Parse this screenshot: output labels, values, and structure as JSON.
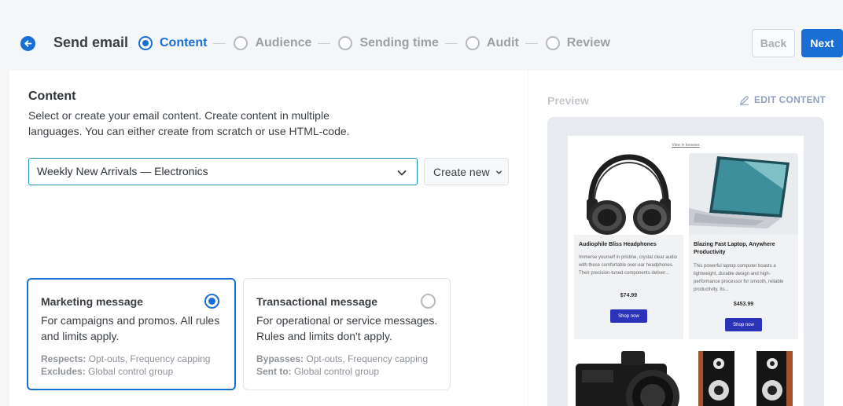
{
  "header": {
    "title": "Send email",
    "steps": [
      {
        "label": "Content",
        "active": true
      },
      {
        "label": "Audience",
        "active": false
      },
      {
        "label": "Sending time",
        "active": false
      },
      {
        "label": "Audit",
        "active": false
      },
      {
        "label": "Review",
        "active": false
      }
    ],
    "back_label": "Back",
    "next_label": "Next"
  },
  "content": {
    "heading": "Content",
    "description": "Select or create your email content. Create content in multiple languages. You can either create from scratch or use HTML-code.",
    "selected_content": "Weekly New Arrivals — Electronics",
    "create_new_label": "Create new"
  },
  "message_types": {
    "marketing": {
      "title": "Marketing message",
      "description": "For campaigns and promos. All rules and limits apply.",
      "meta1_key": "Respects:",
      "meta1_value": "Opt-outs, Frequency capping",
      "meta2_key": "Excludes:",
      "meta2_value": "Global control group",
      "selected": true
    },
    "transactional": {
      "title": "Transactional message",
      "description": "For operational or service messages. Rules and limits don't apply.",
      "meta1_key": "Bypasses:",
      "meta1_value": "Opt-outs, Frequency capping",
      "meta2_key": "Sent to:",
      "meta2_value": "Global control group",
      "selected": false
    }
  },
  "preview": {
    "label": "Preview",
    "edit_label": "EDIT CONTENT",
    "view_in_browser": "View in browser",
    "products": [
      {
        "name": "Audiophile Bliss Headphones",
        "description": "Immerse yourself in pristine, crystal clear audio with these comfortable over-ear headphones. Their precision-tuned components deliver...",
        "price": "$74.99",
        "button": "Shop now",
        "image_icon": "headphones-image"
      },
      {
        "name": "Blazing Fast Laptop, Anywhere Productivity",
        "description": "This powerful laptop computer boasts a lightweight, durable design and high-performance processor for smooth, reliable productivity. Its...",
        "price": "$453.99",
        "button": "Shop now",
        "image_icon": "laptop-image"
      },
      {
        "image_icon": "camera-image"
      },
      {
        "image_icon": "speakers-image"
      }
    ]
  },
  "colors": {
    "accent": "#1a6fd4",
    "shop_button": "#2b34b8"
  }
}
